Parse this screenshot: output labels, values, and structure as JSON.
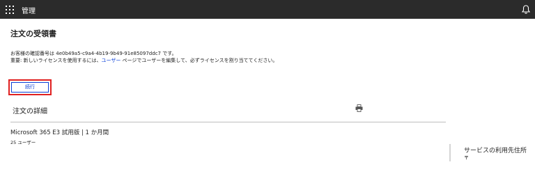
{
  "topbar": {
    "app_title": "管理",
    "waffle_icon": "app-launcher-icon",
    "notification_icon": "bell-icon",
    "background_color": "#2b2b2b"
  },
  "page": {
    "title": "注文の受領書",
    "confirmation_prefix": "お客様の確認番号は ",
    "confirmation_number": "4e0b49a5-c9a4-4b19-9b49-91e85097ddc7",
    "confirmation_suffix": " です。",
    "notice_prefix": "重要: 新しいライセンスを使用するには、",
    "notice_link": "ユーザー",
    "notice_suffix": " ページでユーザーを編集して、必ずライセンスを割り当ててください。",
    "continue_label": "続行"
  },
  "details": {
    "heading": "注文の詳細",
    "print_icon": "printer-icon",
    "product_name": "Microsoft 365 E3 試用版 | 1 か月間",
    "users": "25 ユーザー"
  },
  "sidebar": {
    "heading": "サービスの利用先住所",
    "postal_mark": "〒"
  },
  "colors": {
    "accent": "#0a3fd8",
    "highlight": "#e02020"
  }
}
